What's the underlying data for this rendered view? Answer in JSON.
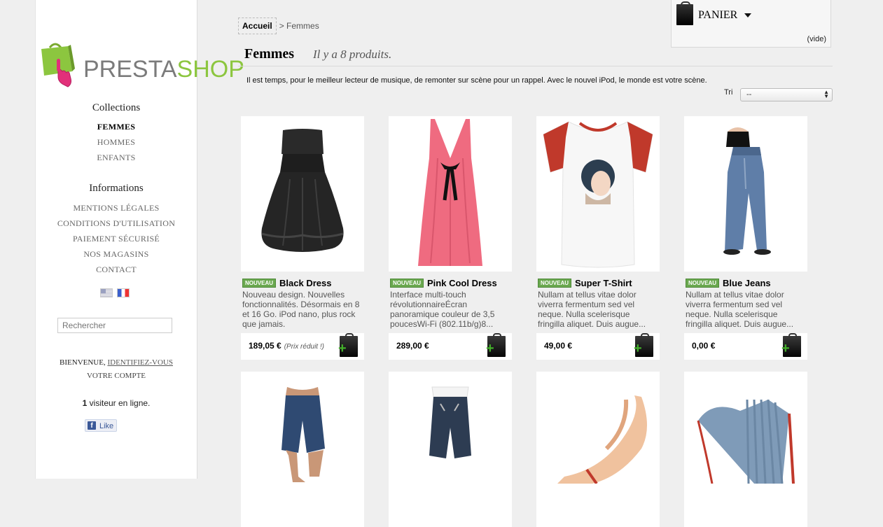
{
  "brand": {
    "part1": "PRESTA",
    "part2": "SHOP"
  },
  "sidebar": {
    "collections_heading": "Collections",
    "collections": [
      {
        "label": "FEMMES",
        "active": true
      },
      {
        "label": "HOMMES",
        "active": false
      },
      {
        "label": "ENFANTS",
        "active": false
      }
    ],
    "info_heading": "Informations",
    "info_links": [
      "MENTIONS LÉGALES",
      "CONDITIONS D'UTILISATION",
      "PAIEMENT SÉCURISÉ",
      "NOS MAGASINS",
      "CONTACT"
    ],
    "search_placeholder": "Rechercher",
    "welcome_text": "BIENVENUE,",
    "login_link": "IDENTIFIEZ-VOUS",
    "account_link": "VOTRE COMPTE",
    "visitors_count": "1",
    "visitors_text": "visiteur en ligne.",
    "fb_like": "Like"
  },
  "breadcrumb": {
    "home": "Accueil",
    "separator": ">",
    "current": "Femmes"
  },
  "cart": {
    "label": "PANIER",
    "status": "(vide)"
  },
  "category": {
    "title": "Femmes",
    "count_text": "Il y a 8 produits.",
    "description": "Il est temps, pour le meilleur lecteur de musique, de remonter sur scène pour un rappel. Avec le nouvel iPod, le monde est votre scène.",
    "sort_label": "Tri",
    "sort_value": "--"
  },
  "products": [
    {
      "badge": "NOUVEAU",
      "name": "Black Dress",
      "desc": "Nouveau design. Nouvelles fonctionnalités. Désormais en 8 et 16 Go. iPod nano, plus rock que jamais.",
      "price": "189,05 €",
      "reduced": "(Prix réduit !)"
    },
    {
      "badge": "NOUVEAU",
      "name": "Pink Cool Dress",
      "desc": "Interface multi-touch révolutionnaireÉcran panoramique couleur de 3,5 poucesWi-Fi (802.11b/g)8...",
      "price": "289,00 €",
      "reduced": ""
    },
    {
      "badge": "NOUVEAU",
      "name": "Super T-Shirt",
      "desc": "Nullam at tellus vitae dolor viverra fermentum sed vel neque. Nulla scelerisque fringilla aliquet. Duis augue...",
      "price": "49,00 €",
      "reduced": ""
    },
    {
      "badge": "NOUVEAU",
      "name": "Blue Jeans",
      "desc": "Nullam at tellus vitae dolor viverra fermentum sed vel neque. Nulla scelerisque fringilla aliquet. Duis augue...",
      "price": "0,00 €",
      "reduced": ""
    }
  ]
}
